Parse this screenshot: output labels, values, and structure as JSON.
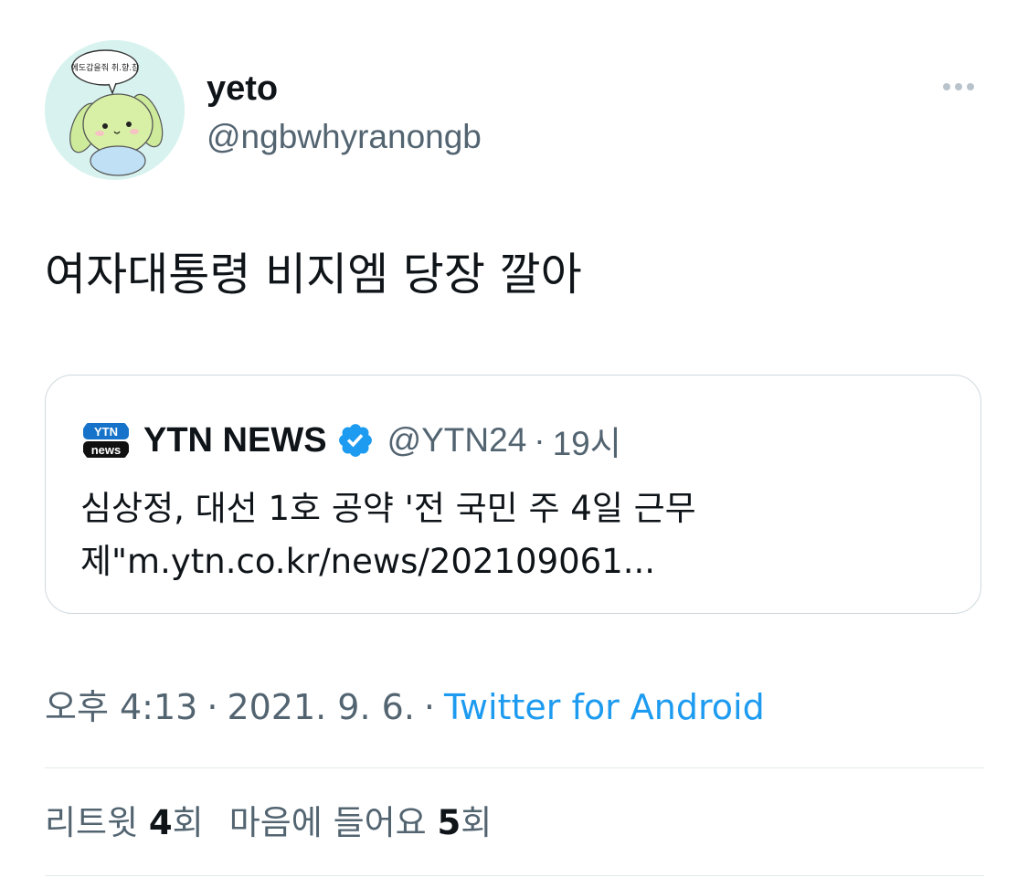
{
  "tweet": {
    "author": {
      "display_name": "yeto",
      "handle": "@ngbwhyranongb",
      "avatar_icon": "cartoon-puppy-avatar",
      "avatar_bubble_text": "에도갑을줘 취.향.참"
    },
    "more_icon": "more-horizontal-icon",
    "text": "여자대통령 비지엠 당장 깔아",
    "quote": {
      "logo_top": "YTN",
      "logo_bottom": "news",
      "name": "YTN NEWS",
      "verified_icon": "verified-badge-icon",
      "handle": "@YTN24",
      "separator": "·",
      "time": "19시",
      "body_line1": "심상정, 대선 1호 공약 '전 국민 주 4일 근무",
      "body_line2": "제\"m.ytn.co.kr/news/202109061..."
    },
    "timestamp": {
      "time": "오후 4:13",
      "date": "2021. 9. 6.",
      "separator": "·",
      "source": "Twitter for Android"
    },
    "stats": {
      "retweets_label": "리트윗",
      "retweets_count": "4",
      "retweets_suffix": "회",
      "likes_label": "마음에 들어요",
      "likes_count": "5",
      "likes_suffix": "회"
    }
  },
  "colors": {
    "text_primary": "#0f1419",
    "text_secondary": "#536471",
    "link": "#1d9bf0",
    "border": "#cfd9de",
    "avatar_bg": "#d8f3ef",
    "ytn_blue": "#1673c9"
  }
}
